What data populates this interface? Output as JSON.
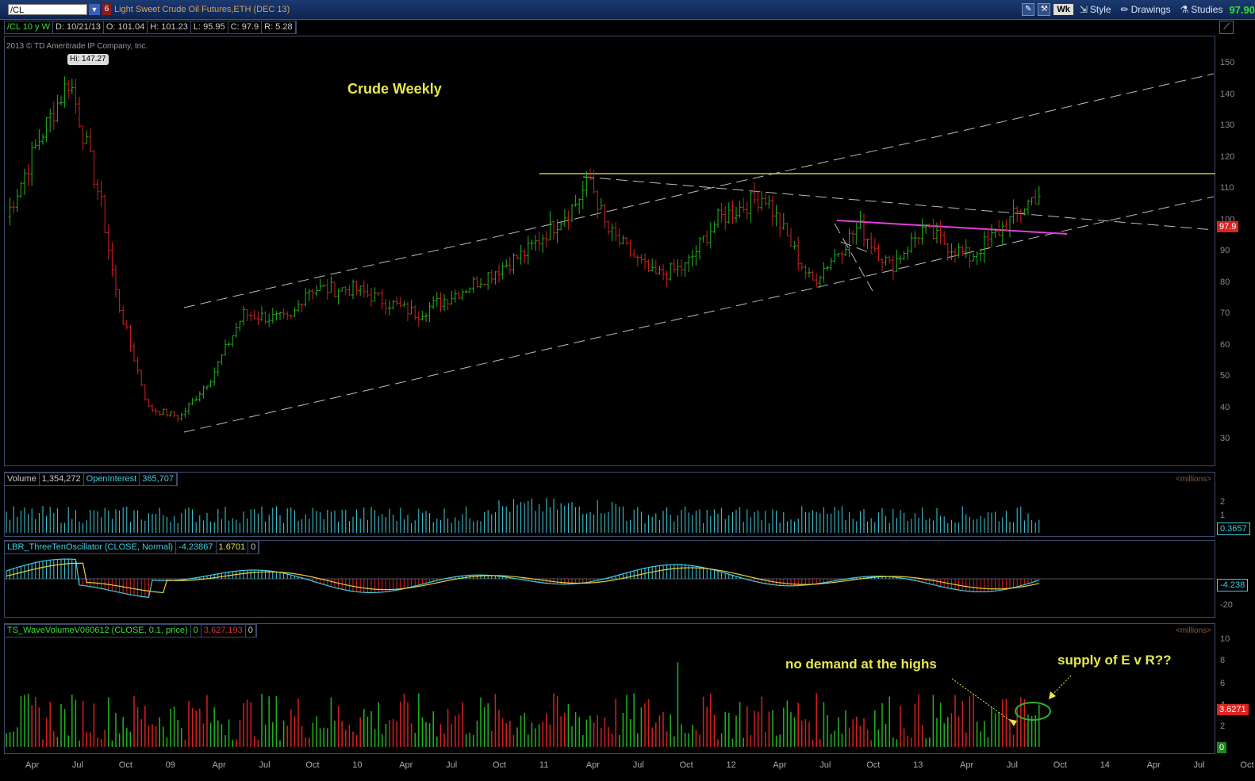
{
  "toolbar": {
    "symbol": "/CL",
    "badge": "6",
    "description": "Light Sweet Crude Oil Futures,ETH (DEC 13)",
    "period": "Wk",
    "style_label": "Style",
    "drawings_label": "Drawings",
    "studies_label": "Studies",
    "last_price": "97.90"
  },
  "price_header": {
    "symbol": "/CL 10 y W",
    "date": "D: 10/21/13",
    "open": "O: 101.04",
    "high": "H: 101.23",
    "low": "L: 95.95",
    "close": "C: 97.9",
    "range": "R: 5.28"
  },
  "copyright": "2013 © TD Ameritrade IP Company, Inc.",
  "chart_title": "Crude Weekly",
  "hi_label": "Hi: 147.27",
  "price_tag": "97.9",
  "volume_header": {
    "label": "Volume",
    "volume": "1,354,272",
    "oi_label": "OpenInterest",
    "oi": "365,707",
    "units": "<millions>"
  },
  "volume_tag": "0.3657",
  "osc_header": {
    "label": "LBR_ThreeTenOscillator (CLOSE, Normal)",
    "v1": "-4.23867",
    "v2": "1.6701",
    "v3": "0"
  },
  "osc_tag": "-4.238",
  "wave_header": {
    "label": "TS_WaveVolumeV060612 (CLOSE, 0.1, price)",
    "v1": "0",
    "v2": "3,627,193",
    "v3": "0",
    "units": "<millions>"
  },
  "wave_tag": "3.6271",
  "wave_zero_tag": "0",
  "annotations": {
    "no_demand": "no demand at the highs",
    "supply": "supply of E v R??"
  },
  "colors": {
    "up": "#21b421",
    "down": "#d62020",
    "title": "#e8e84a",
    "magenta": "#e040e0",
    "cyan": "#3fd0e0",
    "yellow_line": "#c8c840"
  },
  "chart_data": {
    "type": "ohlc",
    "title": "Crude Weekly",
    "y_axis_ticks": [
      "150",
      "140",
      "130",
      "120",
      "110",
      "100",
      "90",
      "80",
      "70",
      "60",
      "50",
      "40",
      "30"
    ],
    "ylim": [
      27,
      153
    ],
    "x_axis_ticks": [
      "Apr",
      "Jul",
      "Oct",
      "09",
      "Apr",
      "Jul",
      "Oct",
      "10",
      "Apr",
      "Jul",
      "Oct",
      "11",
      "Apr",
      "Jul",
      "Oct",
      "12",
      "Apr",
      "Jul",
      "Oct",
      "13",
      "Apr",
      "Jul",
      "Oct",
      "14",
      "Apr",
      "Jul",
      "Oct"
    ],
    "price_path": [
      {
        "date": "2008-03",
        "price": 101
      },
      {
        "date": "2008-05",
        "price": 125
      },
      {
        "date": "2008-07",
        "price": 145
      },
      {
        "date": "2008-09",
        "price": 105
      },
      {
        "date": "2008-10",
        "price": 75
      },
      {
        "date": "2008-12",
        "price": 40
      },
      {
        "date": "2009-02",
        "price": 37
      },
      {
        "date": "2009-04",
        "price": 50
      },
      {
        "date": "2009-06",
        "price": 70
      },
      {
        "date": "2009-09",
        "price": 68
      },
      {
        "date": "2009-10",
        "price": 78
      },
      {
        "date": "2010-01",
        "price": 78
      },
      {
        "date": "2010-05",
        "price": 70
      },
      {
        "date": "2010-08",
        "price": 78
      },
      {
        "date": "2010-12",
        "price": 90
      },
      {
        "date": "2011-03",
        "price": 105
      },
      {
        "date": "2011-04",
        "price": 113
      },
      {
        "date": "2011-05",
        "price": 97
      },
      {
        "date": "2011-08",
        "price": 82
      },
      {
        "date": "2011-10",
        "price": 85
      },
      {
        "date": "2011-12",
        "price": 100
      },
      {
        "date": "2012-03",
        "price": 108
      },
      {
        "date": "2012-06",
        "price": 80
      },
      {
        "date": "2012-09",
        "price": 98
      },
      {
        "date": "2012-11",
        "price": 85
      },
      {
        "date": "2013-01",
        "price": 97
      },
      {
        "date": "2013-04",
        "price": 88
      },
      {
        "date": "2013-06",
        "price": 97
      },
      {
        "date": "2013-08",
        "price": 107
      },
      {
        "date": "2013-09",
        "price": 110
      },
      {
        "date": "2013-10",
        "price": 97.9
      }
    ],
    "hi": 147.27,
    "last": 97.9,
    "volume_axis_ticks": [
      "2",
      "1"
    ],
    "oscillator_axis_ticks": [
      "-20"
    ],
    "wave_axis_ticks": [
      "10",
      "8",
      "6",
      "4",
      "2"
    ]
  }
}
